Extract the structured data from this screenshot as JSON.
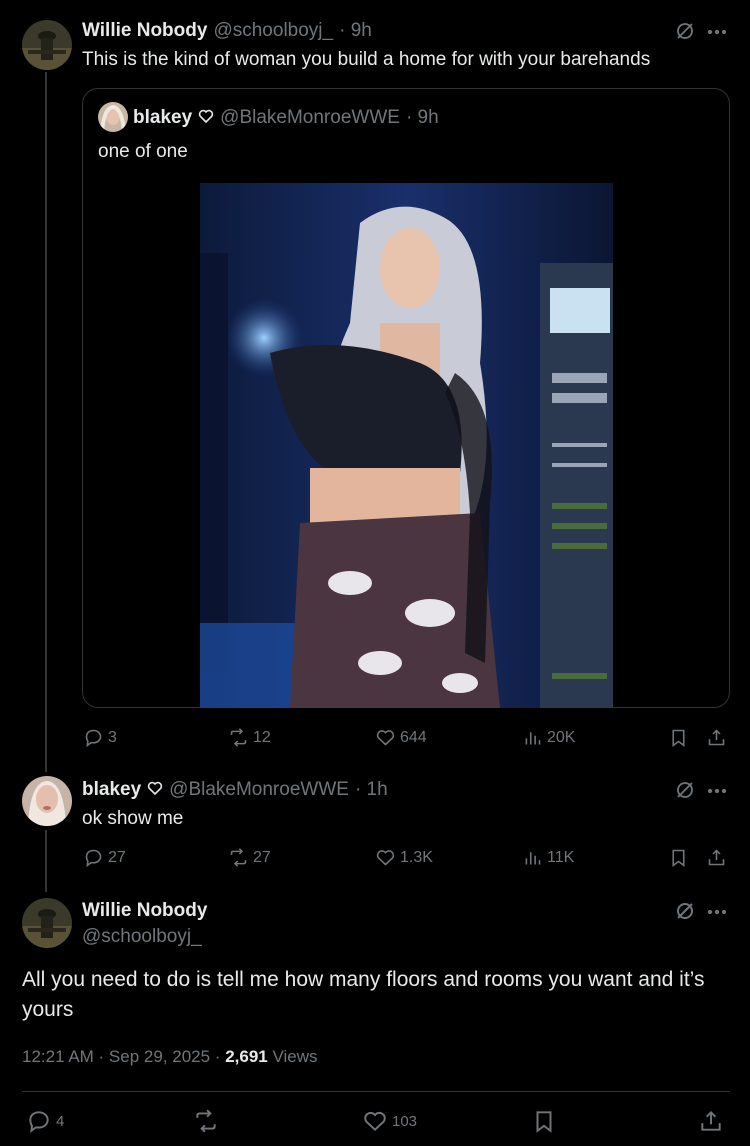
{
  "post1": {
    "name": "Willie Nobody",
    "handle": "@schoolboyj_",
    "time": "· 9h",
    "text": "This is the kind of woman you build a home for with your barehands",
    "quote": {
      "name": "blakey",
      "handle": "@BlakeMonroeWWE",
      "time": "· 9h",
      "text": "one of one"
    },
    "stats": {
      "replies": "3",
      "reposts": "12",
      "likes": "644",
      "views": "20K"
    }
  },
  "post2": {
    "name": "blakey",
    "handle": "@BlakeMonroeWWE",
    "time": "· 1h",
    "text": "ok show me",
    "stats": {
      "replies": "27",
      "reposts": "27",
      "likes": "1.3K",
      "views": "11K"
    }
  },
  "post3": {
    "name": "Willie Nobody",
    "handle": "@schoolboyj_",
    "text": "All you need to do is tell me how many floors and rooms you want and it’s yours",
    "timestamp": "12:21 AM · Sep 29, 2025 · ",
    "views_count": "2,691",
    "views_label": " Views",
    "stats": {
      "replies": "4",
      "likes": "103"
    }
  },
  "colors": {
    "background": "#000000",
    "text": "#e7e9ea",
    "muted": "#71767b",
    "border": "#2f3336"
  },
  "icons": [
    "reply-icon",
    "repost-icon",
    "like-icon",
    "views-icon",
    "bookmark-icon",
    "share-icon",
    "grok-icon",
    "more-icon",
    "heart-badge-icon"
  ]
}
